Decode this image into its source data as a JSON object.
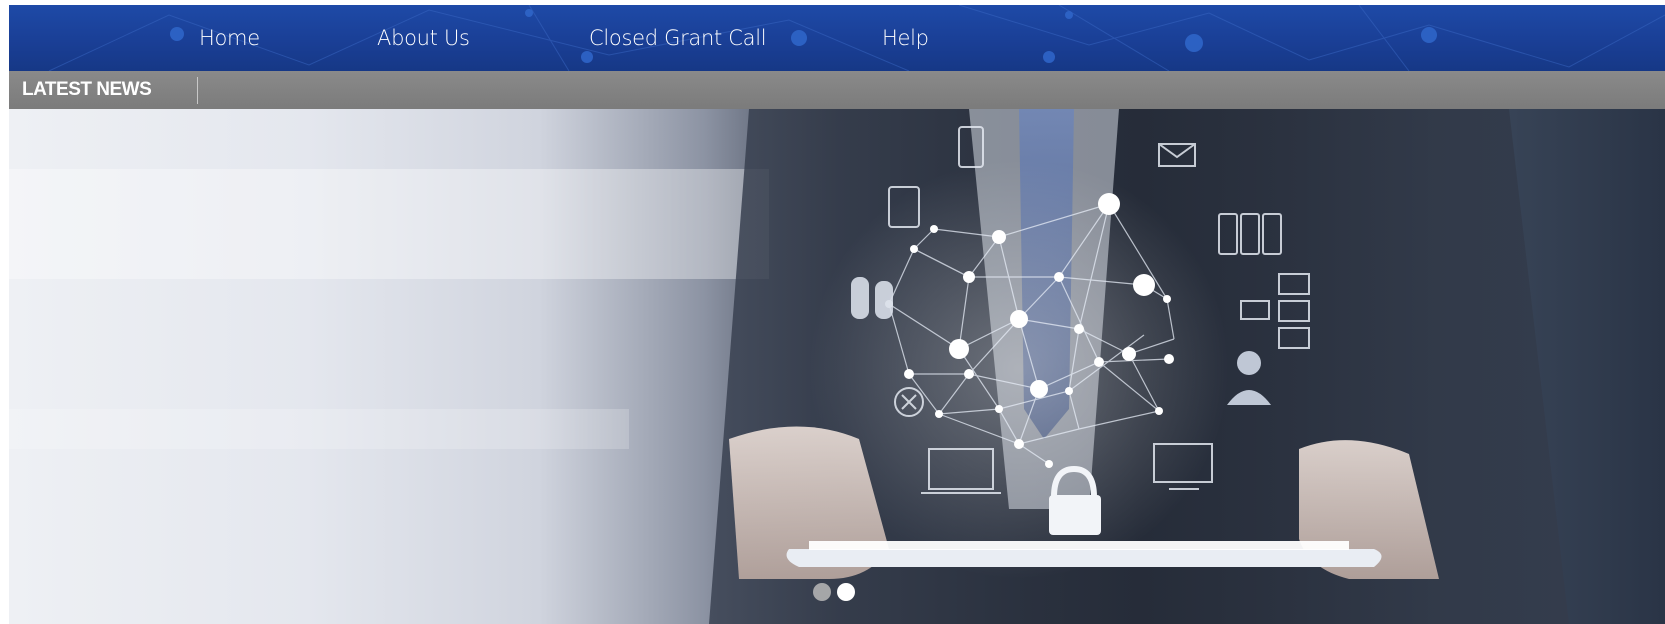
{
  "nav": {
    "items": [
      {
        "label": "Home"
      },
      {
        "label": "About Us"
      },
      {
        "label": "Closed Grant Call"
      },
      {
        "label": "Help"
      }
    ]
  },
  "ticker": {
    "label": "LATEST NEWS"
  },
  "hero": {
    "description_icons": [
      "tablet-icon",
      "server-icon",
      "database-icon",
      "monitor-icon",
      "laptop-icon",
      "padlock-icon",
      "user-icon",
      "mail-icon",
      "network-icon",
      "blocked-icon"
    ],
    "slides": [
      {
        "active": true
      },
      {
        "active": false
      }
    ]
  },
  "colors": {
    "navbar": "#1a3f96",
    "ticker": "#808080",
    "text": "#ffffff"
  }
}
